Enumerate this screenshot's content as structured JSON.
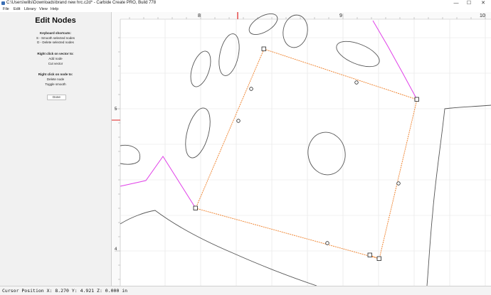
{
  "window": {
    "title": "C:\\Users\\wills\\Downloads\\brand new hrc.c2d* - Carbide Create PRO, Build 778",
    "minimize": "—",
    "maximize": "☐",
    "close": "✕"
  },
  "menu": {
    "file": "File",
    "edit": "Edit",
    "library": "Library",
    "view": "View",
    "help": "Help"
  },
  "sidebar": {
    "title": "Edit Nodes",
    "shortcuts_heading": "Keyboard shortcuts:",
    "shortcut_smooth": "S - Smooth selected nodes",
    "shortcut_delete": "D - Delete selected nodes",
    "vector_heading": "Right click on vector to:",
    "add_node": "Add node",
    "cut_vector": "Cut vector",
    "node_heading": "Right click on node to:",
    "delete_node": "Delete node",
    "toggle_smooth": "Toggle smooth",
    "done_label": "Done"
  },
  "ruler": {
    "x_labels": [
      "8",
      "9",
      "10"
    ],
    "y_labels": [
      "5",
      "4"
    ]
  },
  "status": {
    "text": "Cursor Position X: 8.270 Y: 4.921 Z: 0.000 in"
  },
  "colors": {
    "path": "#f08a3a",
    "selected_vector": "#e040e8",
    "ruler_marker": "#e02020",
    "geometry": "#555555"
  }
}
